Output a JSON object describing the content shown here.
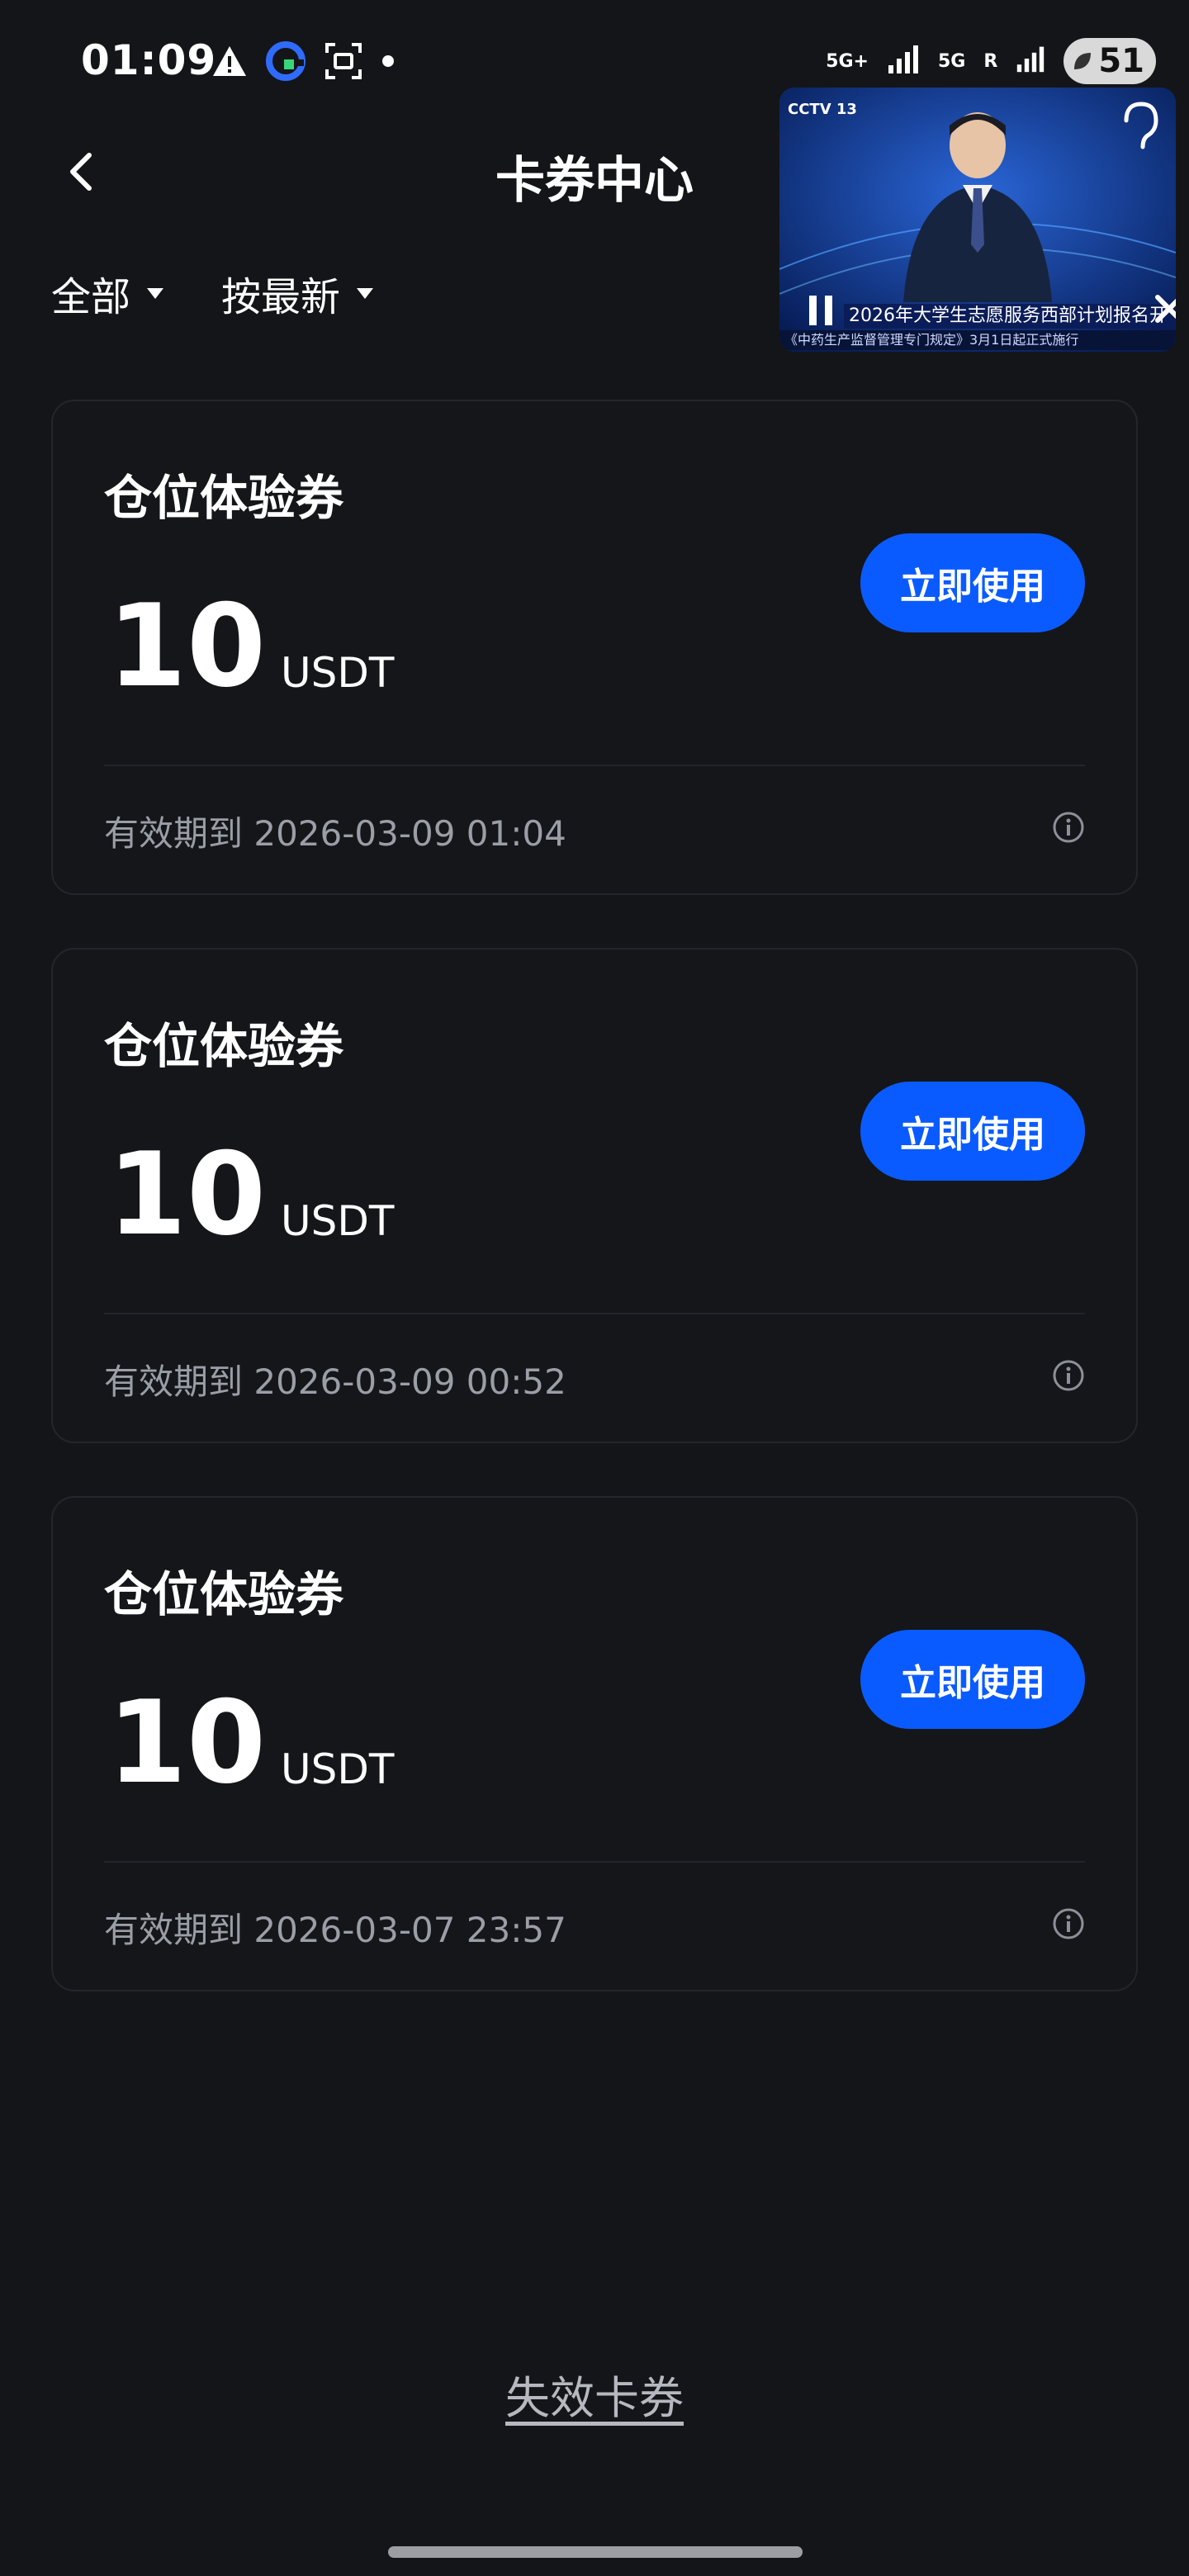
{
  "status_bar": {
    "time": "01:09",
    "network_1": "5G+",
    "network_2": "5G",
    "network_3": "R",
    "battery": "51",
    "icons": [
      "warning-icon",
      "app-logo-icon",
      "screenshot-icon",
      "dot-icon"
    ]
  },
  "header": {
    "title": "卡券中心",
    "back_icon": "chevron-left-icon"
  },
  "filters": {
    "category": "全部",
    "sort": "按最新"
  },
  "coupons": [
    {
      "title": "仓位体验券",
      "amount": "10",
      "unit": "USDT",
      "button": "立即使用",
      "expiry": "有效期到 2026-03-09 01:04"
    },
    {
      "title": "仓位体验券",
      "amount": "10",
      "unit": "USDT",
      "button": "立即使用",
      "expiry": "有效期到 2026-03-09 00:52"
    },
    {
      "title": "仓位体验券",
      "amount": "10",
      "unit": "USDT",
      "button": "立即使用",
      "expiry": "有效期到 2026-03-07 23:57"
    }
  ],
  "footer": {
    "expired_link": "失效卡券"
  },
  "pip_video": {
    "channel": "CCTV 13",
    "headline": "2026年大学生志愿服务西部计划报名开",
    "ticker": "《中药生产监督管理专门规定》3月1日起正式施行"
  },
  "colors": {
    "background": "#141518",
    "accent": "#0a5bff",
    "muted_text": "#9a9ea6"
  }
}
